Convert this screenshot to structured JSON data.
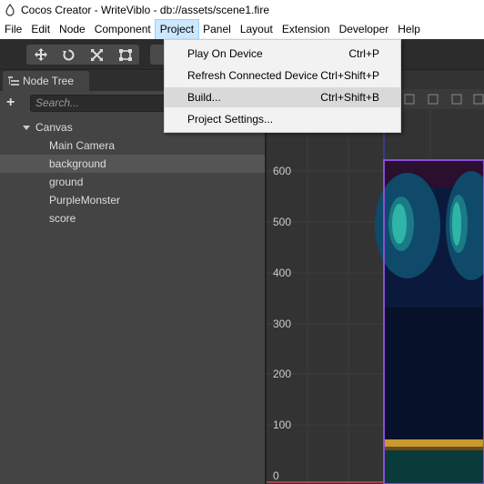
{
  "window": {
    "title": "Cocos Creator - WriteViblo - db://assets/scene1.fire"
  },
  "menubar": {
    "items": [
      "File",
      "Edit",
      "Node",
      "Component",
      "Project",
      "Panel",
      "Layout",
      "Extension",
      "Developer",
      "Help"
    ],
    "active": "Project"
  },
  "project_menu": {
    "items": [
      {
        "label": "Play On Device",
        "shortcut": "Ctrl+P"
      },
      {
        "label": "Refresh Connected Device",
        "shortcut": "Ctrl+Shift+P"
      },
      {
        "label": "Build...",
        "shortcut": "Ctrl+Shift+B"
      },
      {
        "label": "Project Settings...",
        "shortcut": ""
      }
    ],
    "highlighted": "Build..."
  },
  "toolbar": {
    "tools": [
      "move-tool",
      "rotate-tool",
      "scale-tool",
      "rect-tool"
    ]
  },
  "node_tree": {
    "tab_label": "Node Tree",
    "search_placeholder": "Search...",
    "root": "Canvas",
    "children": [
      "Main Camera",
      "background",
      "ground",
      "PurpleMonster",
      "score"
    ],
    "selected": "background"
  },
  "scene": {
    "y_axis_labels": [
      "600",
      "500",
      "400",
      "300",
      "200",
      "100",
      "0"
    ]
  },
  "colors": {
    "menu_active_bg": "#cce8ff",
    "menu_highlight_bg": "#d9d9d9",
    "canvas_border": "#8a4fd8",
    "selection_bg": "#555555"
  }
}
